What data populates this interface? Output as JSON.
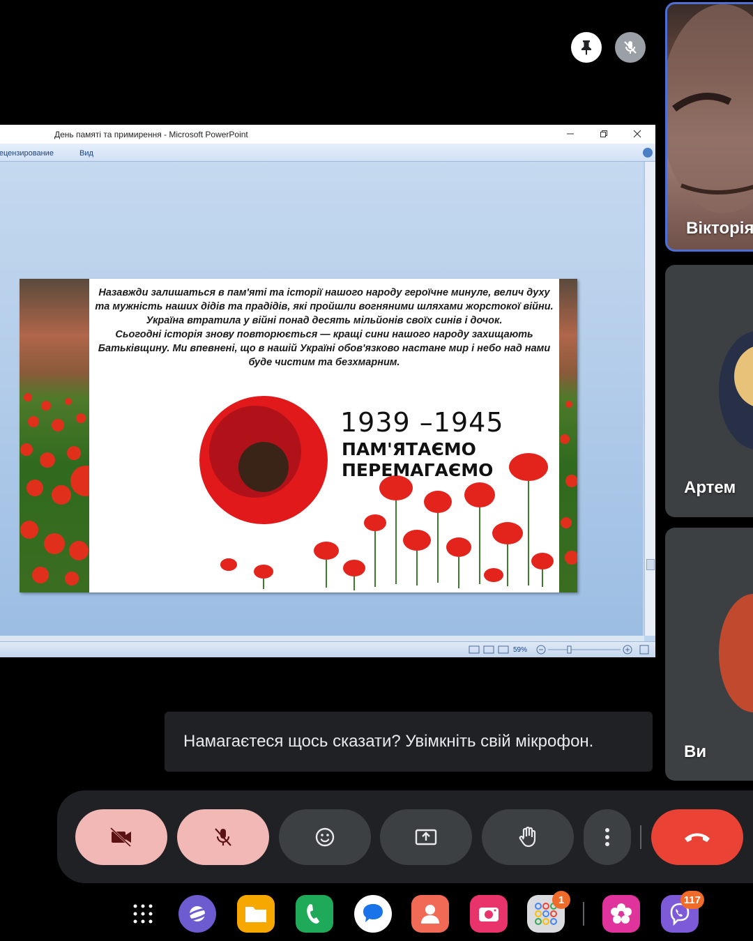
{
  "main": {
    "pin_icon": "pin-icon",
    "mic_off_icon": "mic-off-icon",
    "powerpoint": {
      "window_title": "День памяті та примирення - Microsoft PowerPoint",
      "ribbon_tab_1": "Рецензирование",
      "ribbon_tab_2": "Вид",
      "zoom": "59%",
      "slide": {
        "paragraph_1": "Назавжди залишаться в пам'яті та історії нашого народу героїчне минуле, велич духу та мужність наших дідів та прадідів, які пройшли вогняними шляхами жорстокої війни. Україна втратила у війні понад десять мільйонів своїх синів і дочок.",
        "paragraph_2": "Сьогодні історія знову повторюється — кращі сини нашого народу захищають Батьківщину. Ми впевнені, що в нашій Україні обов'язково настане мир і небо над нами буде чистим та безхмарним.",
        "years": "1939 –1945",
        "slogan_1": "ПАМ'ЯТАЄМО",
        "slogan_2": "ПЕРЕМАГАЄМО"
      }
    }
  },
  "toast": "Намагаєтеся щось сказати? Увімкніть свій мікрофон.",
  "participants": [
    {
      "name": "Вікторія"
    },
    {
      "name": "Артем"
    },
    {
      "name": "Ви"
    }
  ],
  "controls": {
    "camera": "camera-off-icon",
    "mic": "mic-off-icon",
    "reactions": "emoji-icon",
    "present": "present-screen-icon",
    "raise_hand": "raise-hand-icon",
    "more": "more-vert-icon",
    "hangup": "call-end-icon"
  },
  "dock": {
    "apps": [
      {
        "name": "apps-grid-icon"
      },
      {
        "name": "internet-icon",
        "color": "#6d5bd0"
      },
      {
        "name": "files-icon",
        "color": "#f6a800"
      },
      {
        "name": "phone-icon",
        "color": "#1faa59"
      },
      {
        "name": "messages-icon",
        "color": "#ffffff"
      },
      {
        "name": "contacts-icon",
        "color": "#f06a55"
      },
      {
        "name": "camera-icon",
        "color": "#e8336b"
      },
      {
        "name": "google-folder-icon",
        "badge": "1"
      },
      {
        "name": "blossom-icon",
        "color": "#e0339b"
      },
      {
        "name": "viber-icon",
        "color": "#7d5ad8",
        "badge": "117"
      }
    ]
  },
  "colors": {
    "accent_blue": "#4d6fd6",
    "control_bg": "#202124",
    "button_bg": "#3c4043",
    "muted_red": "#f2b8b5",
    "hangup_red": "#ea4335"
  }
}
